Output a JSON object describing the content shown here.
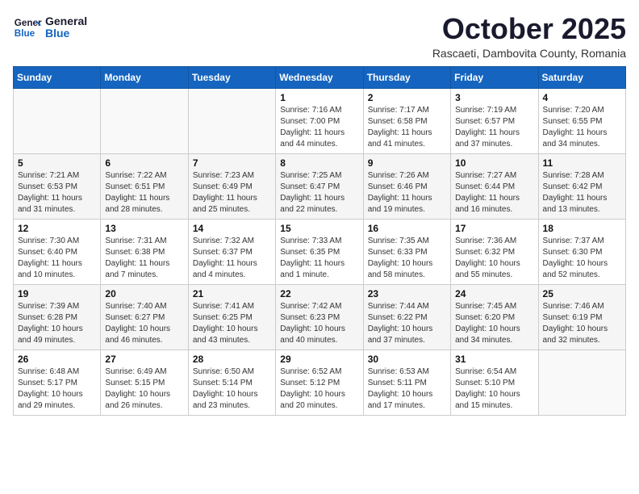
{
  "logo": {
    "line1": "General",
    "line2": "Blue"
  },
  "title": "October 2025",
  "location": "Rascaeti, Dambovita County, Romania",
  "weekdays": [
    "Sunday",
    "Monday",
    "Tuesday",
    "Wednesday",
    "Thursday",
    "Friday",
    "Saturday"
  ],
  "weeks": [
    [
      {
        "day": "",
        "info": ""
      },
      {
        "day": "",
        "info": ""
      },
      {
        "day": "",
        "info": ""
      },
      {
        "day": "1",
        "info": "Sunrise: 7:16 AM\nSunset: 7:00 PM\nDaylight: 11 hours\nand 44 minutes."
      },
      {
        "day": "2",
        "info": "Sunrise: 7:17 AM\nSunset: 6:58 PM\nDaylight: 11 hours\nand 41 minutes."
      },
      {
        "day": "3",
        "info": "Sunrise: 7:19 AM\nSunset: 6:57 PM\nDaylight: 11 hours\nand 37 minutes."
      },
      {
        "day": "4",
        "info": "Sunrise: 7:20 AM\nSunset: 6:55 PM\nDaylight: 11 hours\nand 34 minutes."
      }
    ],
    [
      {
        "day": "5",
        "info": "Sunrise: 7:21 AM\nSunset: 6:53 PM\nDaylight: 11 hours\nand 31 minutes."
      },
      {
        "day": "6",
        "info": "Sunrise: 7:22 AM\nSunset: 6:51 PM\nDaylight: 11 hours\nand 28 minutes."
      },
      {
        "day": "7",
        "info": "Sunrise: 7:23 AM\nSunset: 6:49 PM\nDaylight: 11 hours\nand 25 minutes."
      },
      {
        "day": "8",
        "info": "Sunrise: 7:25 AM\nSunset: 6:47 PM\nDaylight: 11 hours\nand 22 minutes."
      },
      {
        "day": "9",
        "info": "Sunrise: 7:26 AM\nSunset: 6:46 PM\nDaylight: 11 hours\nand 19 minutes."
      },
      {
        "day": "10",
        "info": "Sunrise: 7:27 AM\nSunset: 6:44 PM\nDaylight: 11 hours\nand 16 minutes."
      },
      {
        "day": "11",
        "info": "Sunrise: 7:28 AM\nSunset: 6:42 PM\nDaylight: 11 hours\nand 13 minutes."
      }
    ],
    [
      {
        "day": "12",
        "info": "Sunrise: 7:30 AM\nSunset: 6:40 PM\nDaylight: 11 hours\nand 10 minutes."
      },
      {
        "day": "13",
        "info": "Sunrise: 7:31 AM\nSunset: 6:38 PM\nDaylight: 11 hours\nand 7 minutes."
      },
      {
        "day": "14",
        "info": "Sunrise: 7:32 AM\nSunset: 6:37 PM\nDaylight: 11 hours\nand 4 minutes."
      },
      {
        "day": "15",
        "info": "Sunrise: 7:33 AM\nSunset: 6:35 PM\nDaylight: 11 hours\nand 1 minute."
      },
      {
        "day": "16",
        "info": "Sunrise: 7:35 AM\nSunset: 6:33 PM\nDaylight: 10 hours\nand 58 minutes."
      },
      {
        "day": "17",
        "info": "Sunrise: 7:36 AM\nSunset: 6:32 PM\nDaylight: 10 hours\nand 55 minutes."
      },
      {
        "day": "18",
        "info": "Sunrise: 7:37 AM\nSunset: 6:30 PM\nDaylight: 10 hours\nand 52 minutes."
      }
    ],
    [
      {
        "day": "19",
        "info": "Sunrise: 7:39 AM\nSunset: 6:28 PM\nDaylight: 10 hours\nand 49 minutes."
      },
      {
        "day": "20",
        "info": "Sunrise: 7:40 AM\nSunset: 6:27 PM\nDaylight: 10 hours\nand 46 minutes."
      },
      {
        "day": "21",
        "info": "Sunrise: 7:41 AM\nSunset: 6:25 PM\nDaylight: 10 hours\nand 43 minutes."
      },
      {
        "day": "22",
        "info": "Sunrise: 7:42 AM\nSunset: 6:23 PM\nDaylight: 10 hours\nand 40 minutes."
      },
      {
        "day": "23",
        "info": "Sunrise: 7:44 AM\nSunset: 6:22 PM\nDaylight: 10 hours\nand 37 minutes."
      },
      {
        "day": "24",
        "info": "Sunrise: 7:45 AM\nSunset: 6:20 PM\nDaylight: 10 hours\nand 34 minutes."
      },
      {
        "day": "25",
        "info": "Sunrise: 7:46 AM\nSunset: 6:19 PM\nDaylight: 10 hours\nand 32 minutes."
      }
    ],
    [
      {
        "day": "26",
        "info": "Sunrise: 6:48 AM\nSunset: 5:17 PM\nDaylight: 10 hours\nand 29 minutes."
      },
      {
        "day": "27",
        "info": "Sunrise: 6:49 AM\nSunset: 5:15 PM\nDaylight: 10 hours\nand 26 minutes."
      },
      {
        "day": "28",
        "info": "Sunrise: 6:50 AM\nSunset: 5:14 PM\nDaylight: 10 hours\nand 23 minutes."
      },
      {
        "day": "29",
        "info": "Sunrise: 6:52 AM\nSunset: 5:12 PM\nDaylight: 10 hours\nand 20 minutes."
      },
      {
        "day": "30",
        "info": "Sunrise: 6:53 AM\nSunset: 5:11 PM\nDaylight: 10 hours\nand 17 minutes."
      },
      {
        "day": "31",
        "info": "Sunrise: 6:54 AM\nSunset: 5:10 PM\nDaylight: 10 hours\nand 15 minutes."
      },
      {
        "day": "",
        "info": ""
      }
    ]
  ]
}
